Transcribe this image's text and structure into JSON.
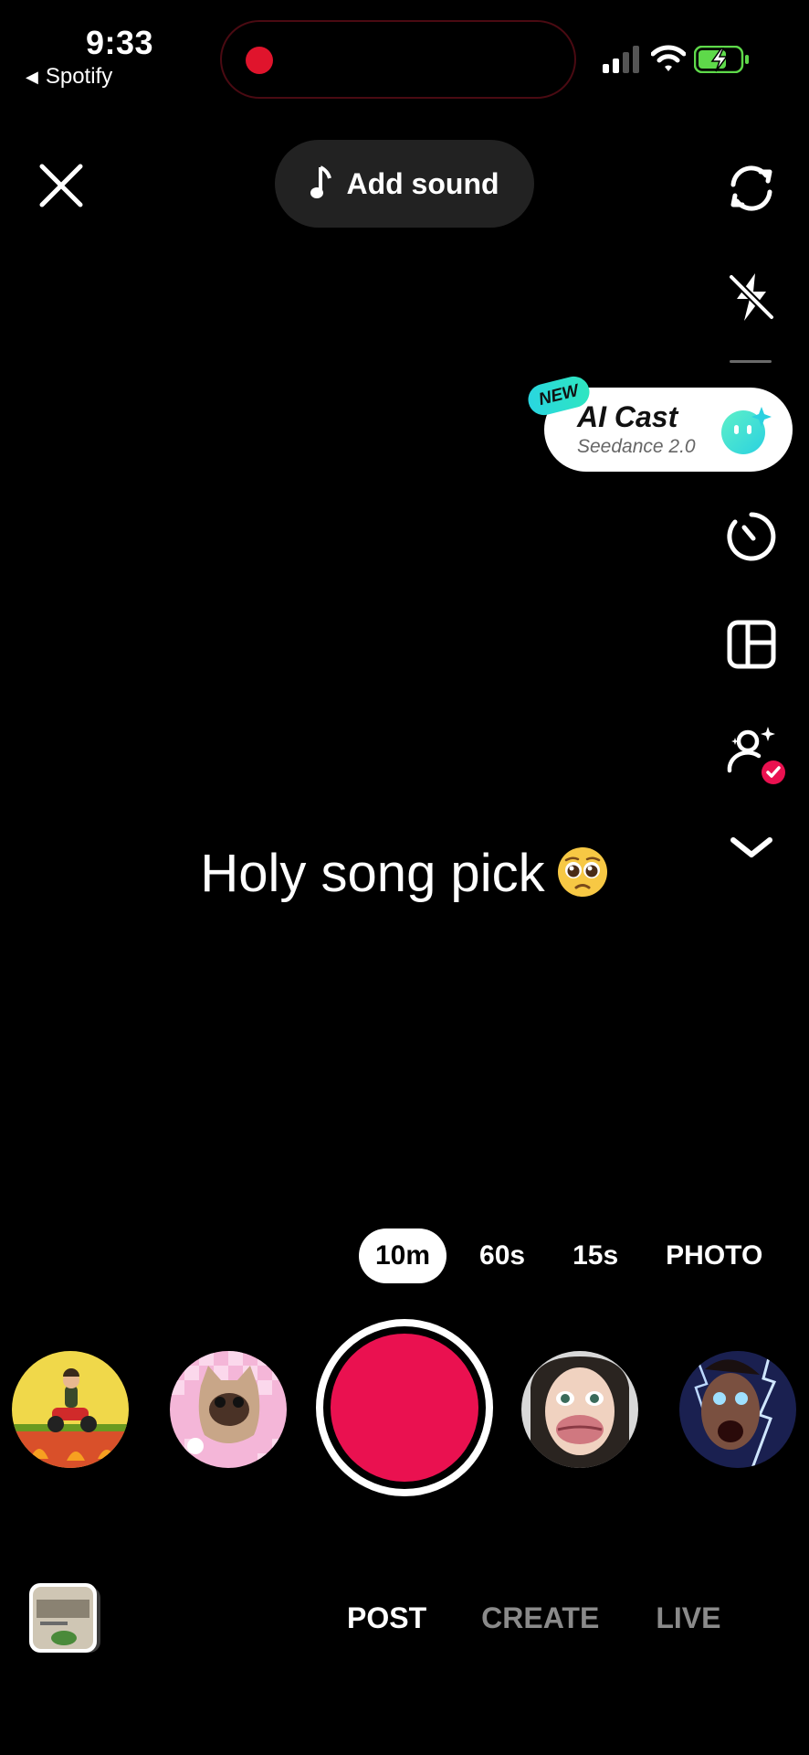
{
  "status_bar": {
    "time": "9:33",
    "back_app": "Spotify",
    "recording_color": "#e0142c",
    "battery_color": "#5ed94a"
  },
  "top": {
    "close_icon": "close-icon",
    "add_sound_label": "Add sound",
    "music_icon": "music-note-icon"
  },
  "right_rail": {
    "flip_icon": "flip-camera-icon",
    "flash_icon": "flash-off-icon",
    "ai_cast": {
      "badge": "NEW",
      "title": "AI Cast",
      "subtitle": "Seedance 2.0"
    },
    "timer_icon": "timer-icon",
    "layout_icon": "layout-grid-icon",
    "retouch_icon": "retouch-person-icon",
    "more_icon": "chevron-down-icon"
  },
  "caption": {
    "text": "Holy song pick",
    "emoji": "pleading-face-emoji"
  },
  "durations": {
    "items": [
      "10m",
      "60s",
      "15s",
      "PHOTO"
    ],
    "selected": "10m"
  },
  "effects": [
    {
      "name": "scooter-game-effect"
    },
    {
      "name": "cat-sticker-effect"
    },
    {
      "name": "big-lips-face-effect"
    },
    {
      "name": "lightning-face-effect"
    }
  ],
  "record_color": "#ea1150",
  "bottom_nav": {
    "tabs": [
      "POST",
      "CREATE",
      "LIVE"
    ],
    "active": "POST"
  }
}
